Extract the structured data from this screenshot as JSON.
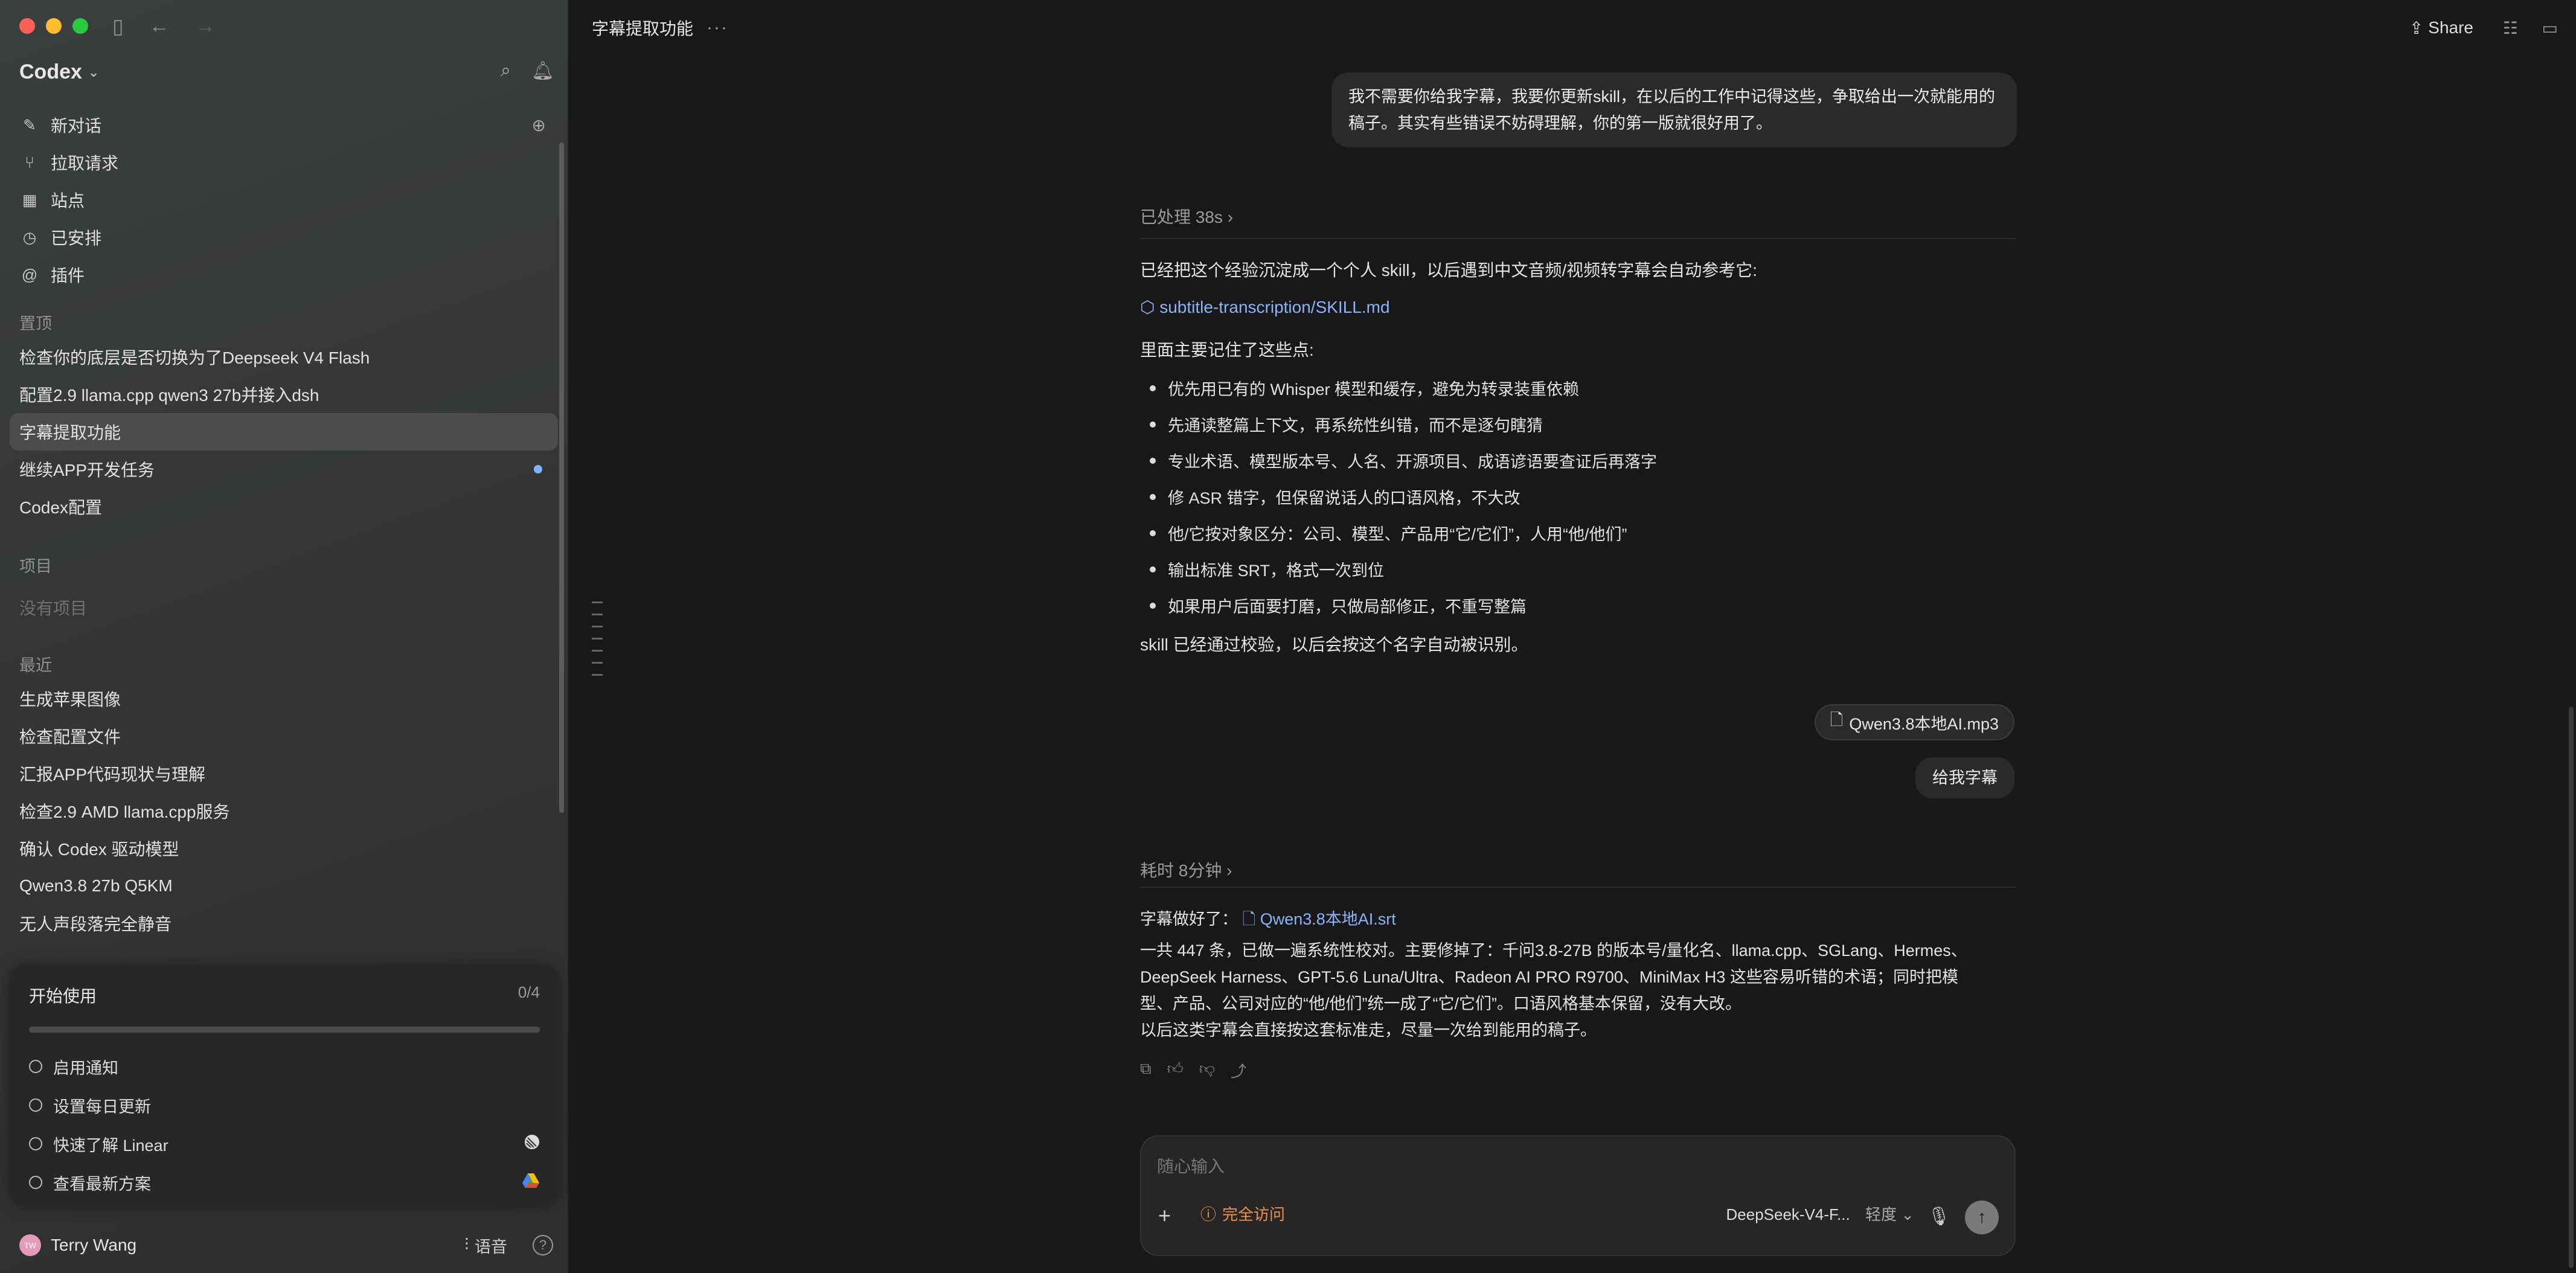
{
  "window": {
    "traffic_colors": [
      "#ff5f57",
      "#febc2e",
      "#28c840"
    ]
  },
  "sidebar": {
    "brand": "Codex",
    "nav": [
      {
        "label": "新对话",
        "icon": "edit-icon"
      },
      {
        "label": "拉取请求",
        "icon": "pull-request-icon"
      },
      {
        "label": "站点",
        "icon": "sites-icon"
      },
      {
        "label": "已安排",
        "icon": "clock-icon"
      },
      {
        "label": "插件",
        "icon": "at-icon"
      }
    ],
    "pinned_label": "置顶",
    "pinned": [
      {
        "label": "检查你的底层是否切换为了Deepseek V4 Flash"
      },
      {
        "label": "配置2.9 llama.cpp qwen3 27b并接入dsh"
      },
      {
        "label": "字幕提取功能",
        "active": true
      },
      {
        "label": "继续APP开发任务",
        "unread": true
      },
      {
        "label": "Codex配置"
      }
    ],
    "projects_label": "项目",
    "no_projects": "没有项目",
    "recent_label": "最近",
    "recent": [
      {
        "label": "生成苹果图像"
      },
      {
        "label": "检查配置文件"
      },
      {
        "label": "汇报APP代码现状与理解"
      },
      {
        "label": "检查2.9 AMD llama.cpp服务"
      },
      {
        "label": "确认 Codex 驱动模型"
      },
      {
        "label": "Qwen3.8 27b Q5KM"
      },
      {
        "label": "无人声段落完全静音"
      }
    ],
    "start": {
      "title": "开始使用",
      "count": "0/4",
      "progress": 0,
      "tasks": [
        {
          "label": "启用通知",
          "icon": ""
        },
        {
          "label": "设置每日更新",
          "icon": ""
        },
        {
          "label": "快速了解 Linear",
          "icon": "linear-logo-icon"
        },
        {
          "label": "查看最新方案",
          "icon": "drive-logo-icon"
        }
      ]
    },
    "user": {
      "name": "Terry Wang",
      "initials": "TW",
      "voice_label": "语音"
    }
  },
  "main": {
    "title": "字幕提取功能",
    "share_label": "Share",
    "messages": {
      "user1": "我不需要你给我字幕，我要你更新skill，在以后的工作中记得这些，争取给出一次就能用的稿子。其实有些错误不妨碍理解，你的第一版就很好用了。",
      "processed": "已处理 38s",
      "intro": "已经把这个经验沉淀成一个个人 skill，以后遇到中文音频/视频转字幕会自动参考它:",
      "skill_link": "subtitle-transcription/SKILL.md",
      "remember": "里面主要记住了这些点:",
      "bullets": [
        "优先用已有的 Whisper 模型和缓存，避免为转录装重依赖",
        "先通读整篇上下文，再系统性纠错，而不是逐句瞎猜",
        "专业术语、模型版本号、人名、开源项目、成语谚语要查证后再落字",
        "修 ASR 错字，但保留说话人的口语风格，不大改",
        "他/它按对象区分：公司、模型、产品用“它/它们”，人用“他/他们”",
        "输出标准 SRT，格式一次到位",
        "如果用户后面要打磨，只做局部修正，不重写整篇"
      ],
      "verified": "skill 已经通过校验，以后会按这个名字自动被识别。",
      "attachment": "Qwen3.8本地AI.mp3",
      "user2": "给我字幕",
      "elapsed": "耗时 8分钟",
      "done_prefix": "字幕做好了：",
      "srt_link": "Qwen3.8本地AI.srt",
      "summary_lines": [
        "一共 447 条，已做一遍系统性校对。主要修掉了：千问3.8-27B 的版本号/量化名、llama.cpp、SGLang、Hermes、",
        "DeepSeek Harness、GPT-5.6 Luna/Ultra、Radeon AI PRO R9700、MiniMax H3 这些容易听错的术语；同时把模",
        "型、产品、公司对应的“他/他们”统一成了“它/它们”。口语风格基本保留，没有大改。"
      ],
      "closing": "以后这类字幕会直接按这套标准走，尽量一次给到能用的稿子。"
    },
    "composer": {
      "placeholder": "随心输入",
      "access_label": "完全访问",
      "model": "DeepSeek-V4-F...",
      "level": "轻度"
    }
  }
}
